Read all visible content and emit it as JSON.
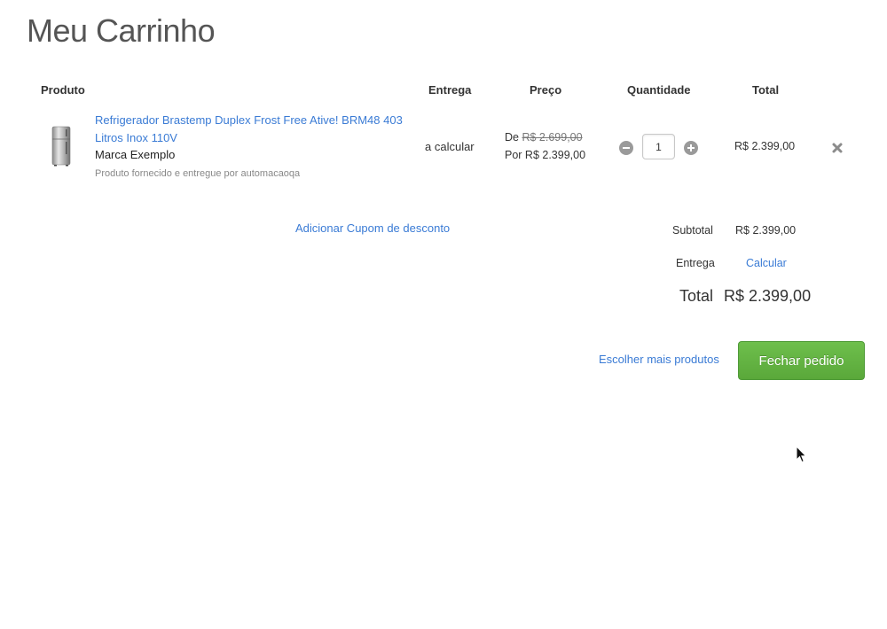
{
  "page": {
    "title": "Meu Carrinho"
  },
  "table": {
    "headers": {
      "product": "Produto",
      "delivery": "Entrega",
      "price": "Preço",
      "quantity": "Quantidade",
      "total": "Total"
    }
  },
  "item": {
    "image_icon": "refrigerator-image",
    "name": "Refrigerador Brastemp Duplex Frost Free Ative! BRM48 403 Litros Inox 110V",
    "brand": "Marca Exemplo",
    "seller": "Produto fornecido e entregue por automacaoqa",
    "delivery": "a calcular",
    "price_from_prefix": "De",
    "price_from_value": "R$ 2.699,00",
    "price_by": "Por R$ 2.399,00",
    "quantity": "1",
    "line_total": "R$ 2.399,00",
    "remove_icon": "close-icon"
  },
  "coupon": {
    "link_label": "Adicionar Cupom de desconto"
  },
  "summary": {
    "subtotal_label": "Subtotal",
    "subtotal_value": "R$ 2.399,00",
    "shipping_label": "Entrega",
    "shipping_action": "Calcular",
    "total_label": "Total",
    "total_value": "R$ 2.399,00"
  },
  "actions": {
    "continue_label": "Escolher mais produtos",
    "checkout_label": "Fechar pedido"
  },
  "colors": {
    "link": "#3a7bd5",
    "checkout": "#62b342"
  }
}
